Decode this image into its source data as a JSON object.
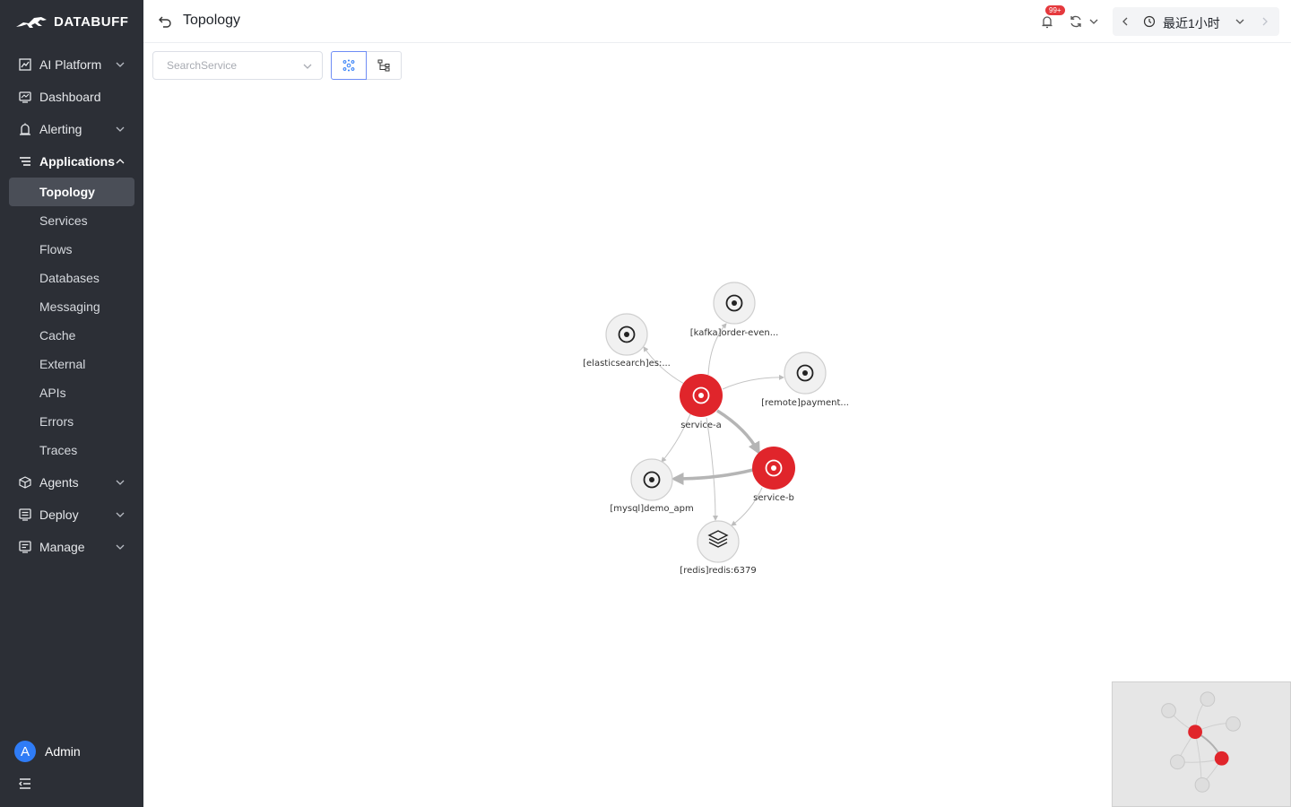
{
  "brand": {
    "name": "DATABUFF"
  },
  "header": {
    "title": "Topology",
    "badge": "99+",
    "time_range": "最近1小时"
  },
  "sidebar": {
    "items": [
      {
        "label": "AI Platform",
        "icon": "chart-icon",
        "expandable": true
      },
      {
        "label": "Dashboard",
        "icon": "dashboard-icon",
        "expandable": false
      },
      {
        "label": "Alerting",
        "icon": "alarm-icon",
        "expandable": true
      },
      {
        "label": "Applications",
        "icon": "list-icon",
        "expandable": true,
        "open": true
      }
    ],
    "sub_items": [
      {
        "label": "Topology",
        "active": true
      },
      {
        "label": "Services"
      },
      {
        "label": "Flows"
      },
      {
        "label": "Databases"
      },
      {
        "label": "Messaging"
      },
      {
        "label": "Cache"
      },
      {
        "label": "External"
      },
      {
        "label": "APIs"
      },
      {
        "label": "Errors"
      },
      {
        "label": "Traces"
      }
    ],
    "bottom_items": [
      {
        "label": "Agents",
        "icon": "cube-icon"
      },
      {
        "label": "Deploy",
        "icon": "deploy-icon"
      },
      {
        "label": "Manage",
        "icon": "manage-icon"
      }
    ],
    "user": {
      "initial": "A",
      "name": "Admin"
    }
  },
  "toolbar": {
    "search_placeholder": "SearchService"
  },
  "graph": {
    "nodes": [
      {
        "id": "service-a",
        "label": "service-a",
        "kind": "service",
        "status": "error"
      },
      {
        "id": "service-b",
        "label": "service-b",
        "kind": "service",
        "status": "error"
      },
      {
        "id": "kafka",
        "label": "[kafka]order-even...",
        "kind": "messaging"
      },
      {
        "id": "es",
        "label": "[elasticsearch]es:...",
        "kind": "database"
      },
      {
        "id": "remote",
        "label": "[remote]payment...",
        "kind": "remote"
      },
      {
        "id": "mysql",
        "label": "[mysql]demo_apm",
        "kind": "database"
      },
      {
        "id": "redis",
        "label": "[redis]redis:6379",
        "kind": "cache"
      }
    ],
    "edges": [
      {
        "from": "service-a",
        "to": "kafka"
      },
      {
        "from": "service-a",
        "to": "es"
      },
      {
        "from": "service-a",
        "to": "remote"
      },
      {
        "from": "service-a",
        "to": "service-b",
        "heavy": true
      },
      {
        "from": "service-a",
        "to": "mysql"
      },
      {
        "from": "service-a",
        "to": "redis"
      },
      {
        "from": "service-b",
        "to": "mysql",
        "heavy": true
      },
      {
        "from": "service-b",
        "to": "redis"
      }
    ]
  },
  "colors": {
    "accent": "#2f7cf6",
    "error": "#e0252b",
    "sidebar_bg": "#2c2f36"
  }
}
